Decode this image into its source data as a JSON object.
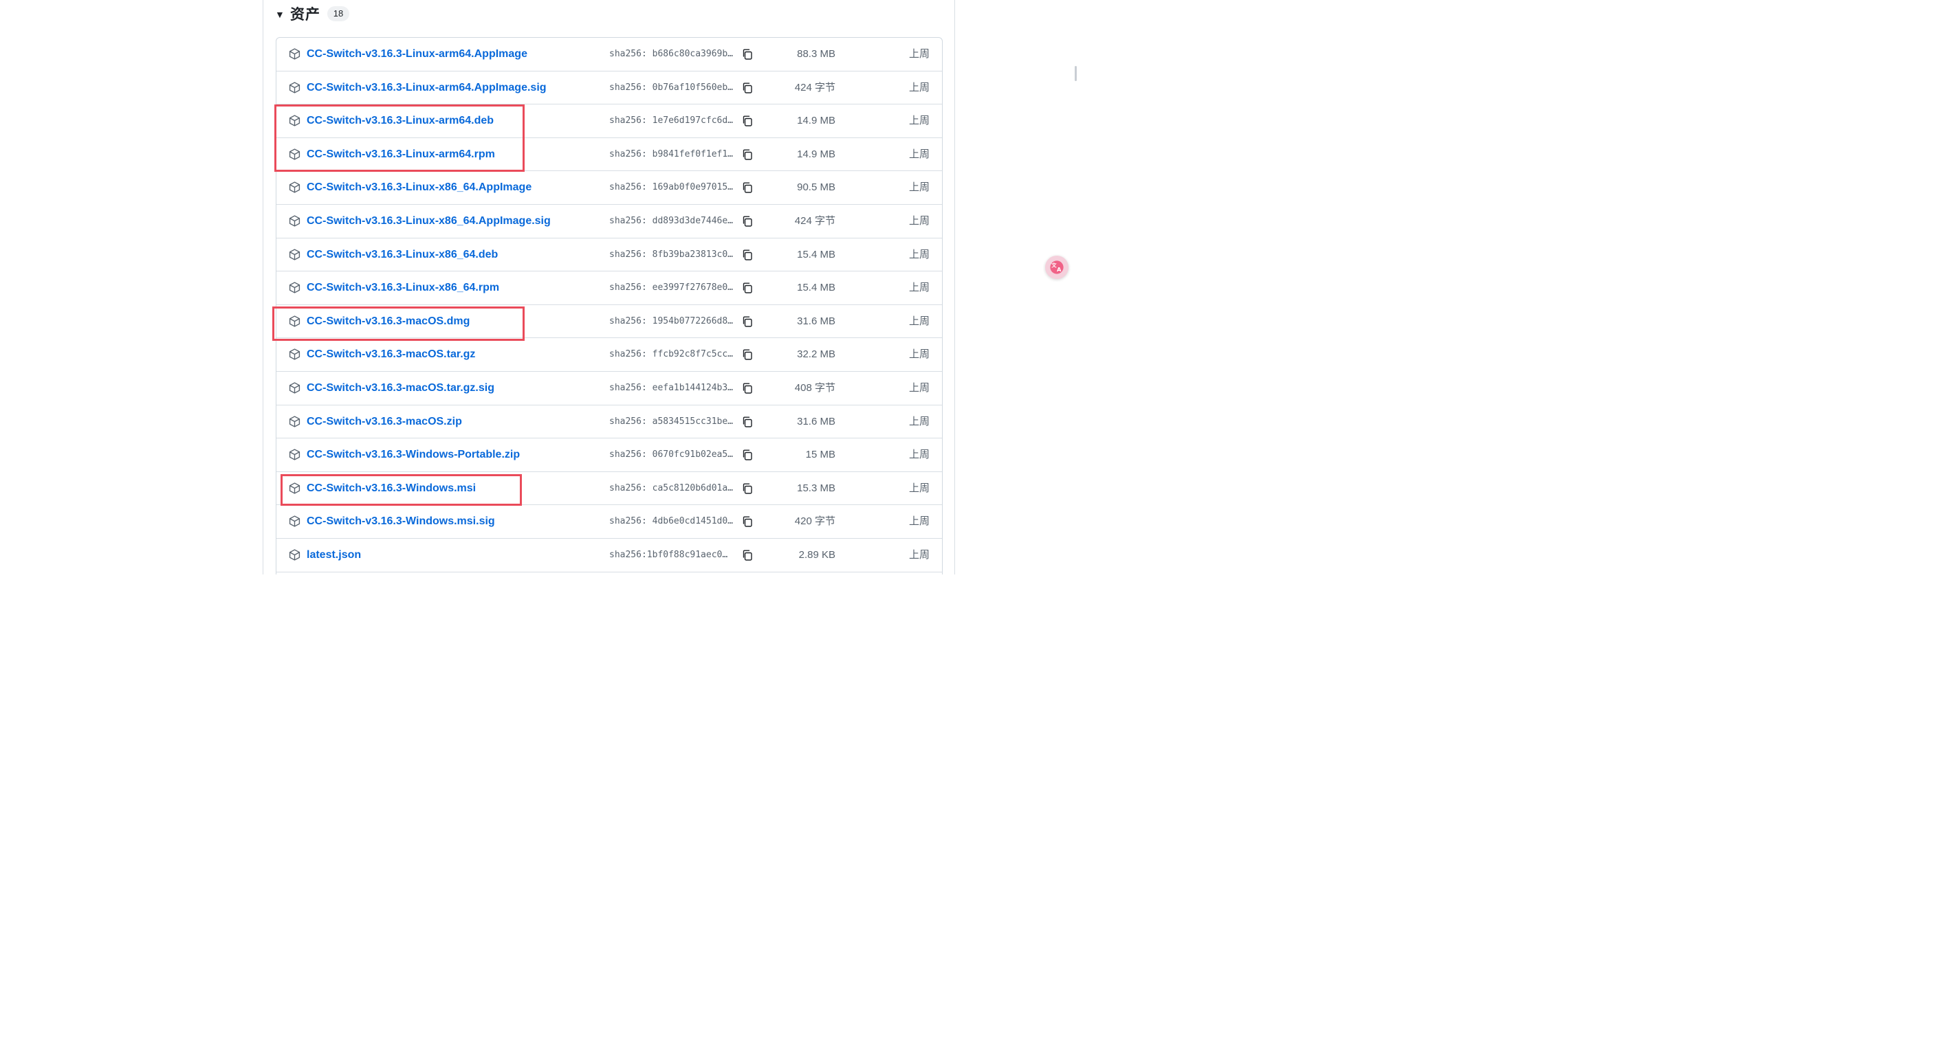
{
  "assets": {
    "title": "资产",
    "count": "18",
    "items": [
      {
        "name": "CC-Switch-v3.16.3-Linux-arm64.AppImage",
        "sha": "sha256: b686c80ca3969b…",
        "size": "88.3 MB",
        "date": "上周"
      },
      {
        "name": "CC-Switch-v3.16.3-Linux-arm64.AppImage.sig",
        "sha": "sha256: 0b76af10f560eb…",
        "size": "424 字节",
        "date": "上周"
      },
      {
        "name": "CC-Switch-v3.16.3-Linux-arm64.deb",
        "sha": "sha256: 1e7e6d197cfc6d…",
        "size": "14.9 MB",
        "date": "上周"
      },
      {
        "name": "CC-Switch-v3.16.3-Linux-arm64.rpm",
        "sha": "sha256: b9841fef0f1ef1…",
        "size": "14.9 MB",
        "date": "上周"
      },
      {
        "name": "CC-Switch-v3.16.3-Linux-x86_64.AppImage",
        "sha": "sha256: 169ab0f0e97015…",
        "size": "90.5 MB",
        "date": "上周"
      },
      {
        "name": "CC-Switch-v3.16.3-Linux-x86_64.AppImage.sig",
        "sha": "sha256: dd893d3de7446e…",
        "size": "424 字节",
        "date": "上周"
      },
      {
        "name": "CC-Switch-v3.16.3-Linux-x86_64.deb",
        "sha": "sha256: 8fb39ba23813c0…",
        "size": "15.4 MB",
        "date": "上周"
      },
      {
        "name": "CC-Switch-v3.16.3-Linux-x86_64.rpm",
        "sha": "sha256: ee3997f27678e0…",
        "size": "15.4 MB",
        "date": "上周"
      },
      {
        "name": "CC-Switch-v3.16.3-macOS.dmg",
        "sha": "sha256: 1954b0772266d8…",
        "size": "31.6 MB",
        "date": "上周"
      },
      {
        "name": "CC-Switch-v3.16.3-macOS.tar.gz",
        "sha": "sha256: ffcb92c8f7c5cc…",
        "size": "32.2 MB",
        "date": "上周"
      },
      {
        "name": "CC-Switch-v3.16.3-macOS.tar.gz.sig",
        "sha": "sha256: eefa1b144124b3…",
        "size": "408 字节",
        "date": "上周"
      },
      {
        "name": "CC-Switch-v3.16.3-macOS.zip",
        "sha": "sha256: a5834515cc31be…",
        "size": "31.6 MB",
        "date": "上周"
      },
      {
        "name": "CC-Switch-v3.16.3-Windows-Portable.zip",
        "sha": "sha256: 0670fc91b02ea5…",
        "size": "15 MB",
        "date": "上周"
      },
      {
        "name": "CC-Switch-v3.16.3-Windows.msi",
        "sha": "sha256: ca5c8120b6d01a…",
        "size": "15.3 MB",
        "date": "上周"
      },
      {
        "name": "CC-Switch-v3.16.3-Windows.msi.sig",
        "sha": "sha256: 4db6e0cd1451d0…",
        "size": "420 字节",
        "date": "上周"
      },
      {
        "name": "latest.json",
        "sha": "sha256:1bf0f88c91aec0…",
        "size": "2.89 KB",
        "date": "上周"
      }
    ]
  },
  "icons": {
    "collapse": "triangle-down-icon",
    "package": "package-icon",
    "copy": "copy-icon",
    "translate": "translate-icon"
  },
  "colors": {
    "link": "#0969da",
    "muted": "#59636e",
    "border": "#d8dee4",
    "highlight": "#ea4b5a",
    "counter_bg": "#eff1f3"
  }
}
